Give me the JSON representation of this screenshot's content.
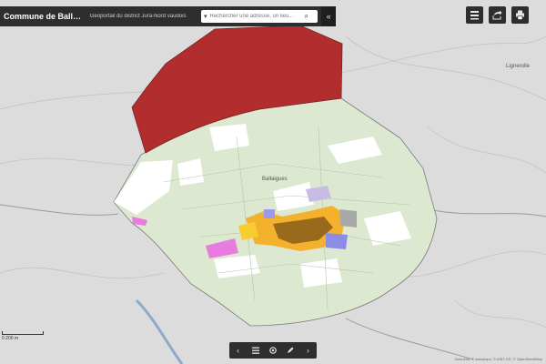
{
  "header": {
    "title": "Commune de Ballaigues",
    "subtitle": "Géoportail du district Jura-Nord vaudois",
    "search_placeholder": "Rechercher une adresse, un lieu..."
  },
  "map": {
    "place_label_center": "Ballaigues",
    "place_label_right": "Lignerolle",
    "scale_text": "0  200 m",
    "attribution": "Données: © swisstopo, © ASIT-VD, © OpenStreetMap"
  },
  "icons": {
    "collapse": "double-chevron-left-icon",
    "layers": "layers-icon",
    "share": "share-icon",
    "print": "print-icon",
    "prev": "chevron-left-icon",
    "list": "list-icon",
    "locate": "locate-icon",
    "draw": "pencil-icon",
    "next": "chevron-right-icon"
  },
  "colors": {
    "toolbar": "#2e2e2e",
    "forest_zone": "#b22e2e",
    "municipality_area": "#dce8cf",
    "building_zone": "#f4b12e",
    "village_center": "#9a6a1c",
    "special_zone_pink": "#e77be0",
    "special_zone_blue": "#8c8ce6"
  }
}
